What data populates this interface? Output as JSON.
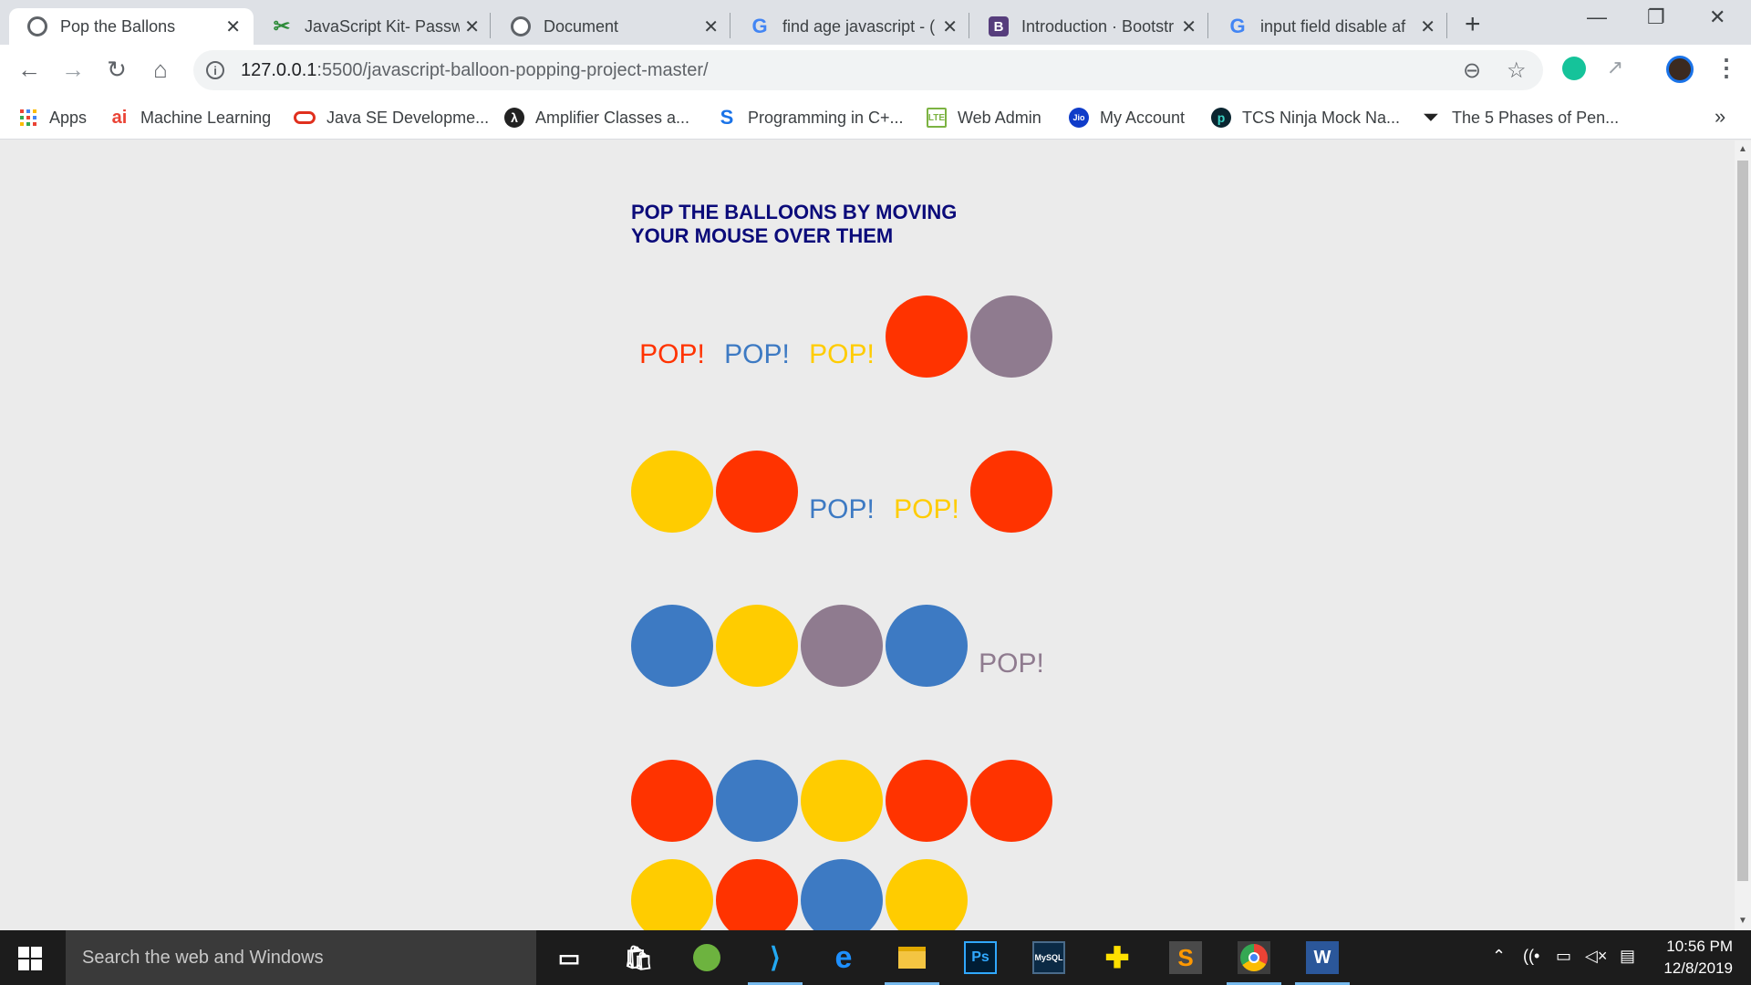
{
  "browser": {
    "tabs": [
      {
        "title": "Pop the Ballons",
        "icon": "globe-icon",
        "active": true
      },
      {
        "title": "JavaScript Kit- Passw",
        "icon": "javascript-kit-icon",
        "active": false
      },
      {
        "title": "Document",
        "icon": "globe-icon",
        "active": false
      },
      {
        "title": "find age javascript - (",
        "icon": "google-icon",
        "active": false
      },
      {
        "title": "Introduction · Bootstr",
        "icon": "bootstrap-icon",
        "active": false
      },
      {
        "title": "input field disable af",
        "icon": "google-icon",
        "active": false
      }
    ],
    "favicon_letters": {
      "google": "G",
      "bootstrap": "B",
      "jskit": "✂"
    },
    "new_tab_label": "+",
    "window_controls": {
      "minimize": "—",
      "maximize": "❐",
      "close": "✕"
    },
    "url_host": "127.0.0.1",
    "url_rest": ":5500/javascript-balloon-popping-project-master/",
    "bookmarks": [
      {
        "label": "Apps",
        "icon": "apps-grid-icon"
      },
      {
        "label": "Machine Learning",
        "icon": "ai-icon"
      },
      {
        "label": "Java SE Developme...",
        "icon": "oracle-icon"
      },
      {
        "label": "Amplifier Classes a...",
        "icon": "amplifier-icon"
      },
      {
        "label": "Programming in C+...",
        "icon": "s-icon"
      },
      {
        "label": "Web Admin",
        "icon": "lte-icon"
      },
      {
        "label": "My Account",
        "icon": "jio-icon"
      },
      {
        "label": "TCS Ninja Mock Na...",
        "icon": "tcs-icon"
      },
      {
        "label": "The 5 Phases of Pen...",
        "icon": "phases-icon"
      }
    ],
    "bookmark_icon_text": {
      "ai": "ai",
      "jio": "Jio",
      "lte": "LTE",
      "s": "S"
    },
    "bookmarks_more": "»"
  },
  "page": {
    "heading_line1": "POP THE BALLOONS BY MOVING",
    "heading_line2": "YOUR MOUSE OVER THEM",
    "pop_text": "POP!",
    "colors": {
      "red": "#ff3300",
      "blue": "#3d7ac3",
      "yellow": "#ffcc00",
      "mauve": "#8f7b8f"
    },
    "rows": [
      [
        "pop-red",
        "pop-blue",
        "pop-yellow",
        "red",
        "mauve"
      ],
      [
        "yellow",
        "red",
        "pop-blue",
        "pop-yellow",
        "red"
      ],
      [
        "blue",
        "yellow",
        "mauve",
        "blue",
        "pop-mauve"
      ],
      [
        "red",
        "blue",
        "yellow",
        "red",
        "red"
      ],
      [
        "yellow",
        "red",
        "blue",
        "yellow"
      ]
    ]
  },
  "taskbar": {
    "search_placeholder": "Search the web and Windows",
    "apps": [
      "task-view-icon",
      "store-icon",
      "spring-icon",
      "vscode-icon",
      "edge-icon",
      "file-explorer-icon",
      "photoshop-icon",
      "mysql-icon",
      "plus-app-icon",
      "sublime-icon",
      "chrome-icon",
      "word-icon"
    ],
    "app_glyphs": {
      "photoshop": "Ps",
      "word": "W",
      "vscode": "⟩",
      "edge": "e",
      "sublime": "S",
      "mysql": "MySQL"
    },
    "time": "10:56 PM",
    "date": "12/8/2019"
  }
}
